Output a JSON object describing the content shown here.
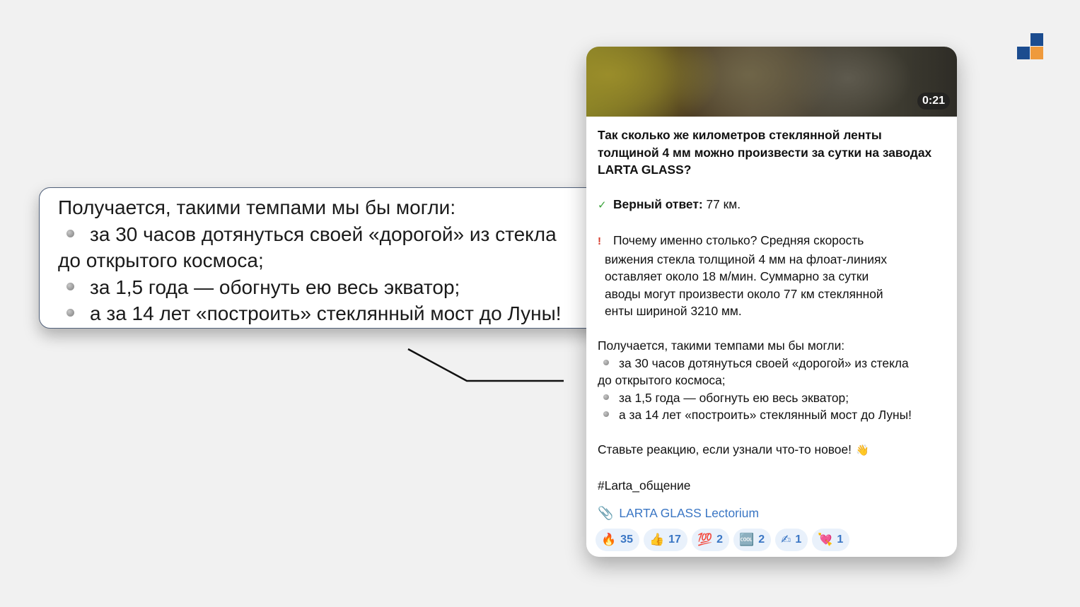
{
  "video": {
    "duration": "0:21"
  },
  "message": {
    "title_lines": [
      "Так сколько же километров стеклянной ленты",
      "толщиной 4 мм можно произвести за сутки на заводах",
      "LARTA GLASS?"
    ],
    "answer_label": "Верный ответ:",
    "answer_value": " 77 км.",
    "why_lines": [
      "Почему именно столько? Средняя скорость",
      "вижения стекла толщиной 4 мм на флоат-линиях",
      "оставляет около 18 м/мин. Суммарно за сутки",
      "аводы могут произвести около 77 км стеклянной",
      "енты шириной 3210 мм."
    ],
    "result_intro": "Получается, такими темпами мы бы могли:",
    "bullets": {
      "b1_line1": "за 30 часов дотянуться своей «дорогой» из стекла",
      "b1_line2": "до открытого космоса;",
      "b2": "за 1,5 года — обогнуть ею весь экватор;",
      "b3": "а за 14 лет «построить» стеклянный мост до Луны!"
    },
    "cta": "Ставьте реакцию, если узнали что-то новое!",
    "hashtag": "#Larta_общение",
    "channel_link": "LARTA GLASS Lectorium"
  },
  "reactions": [
    {
      "emoji": "🔥",
      "count": "35"
    },
    {
      "emoji": "👍",
      "count": "17"
    },
    {
      "emoji": "💯",
      "count": "2"
    },
    {
      "emoji": "🆒",
      "count": "2"
    },
    {
      "emoji": "✍",
      "count": "1"
    },
    {
      "emoji": "💘",
      "count": "1"
    }
  ],
  "callout": {
    "intro": "Получается, такими темпами мы бы могли:",
    "b1_line1": "за 30 часов дотянуться своей «дорогой» из стекла",
    "b1_line2": "до открытого космоса;",
    "b2": "за 1,5 года — обогнуть ею весь экватор;",
    "b3": "а за 14 лет «построить» стеклянный мост до Луны!"
  },
  "colors": {
    "brand_blue": "#1b4c8f",
    "brand_orange": "#ef9a3c",
    "link": "#3a76c4"
  },
  "icons": {
    "answer": "check-mark-icon",
    "why": "exclamation-icon",
    "cta": "waving-hand-icon",
    "link": "paperclip-icon"
  }
}
